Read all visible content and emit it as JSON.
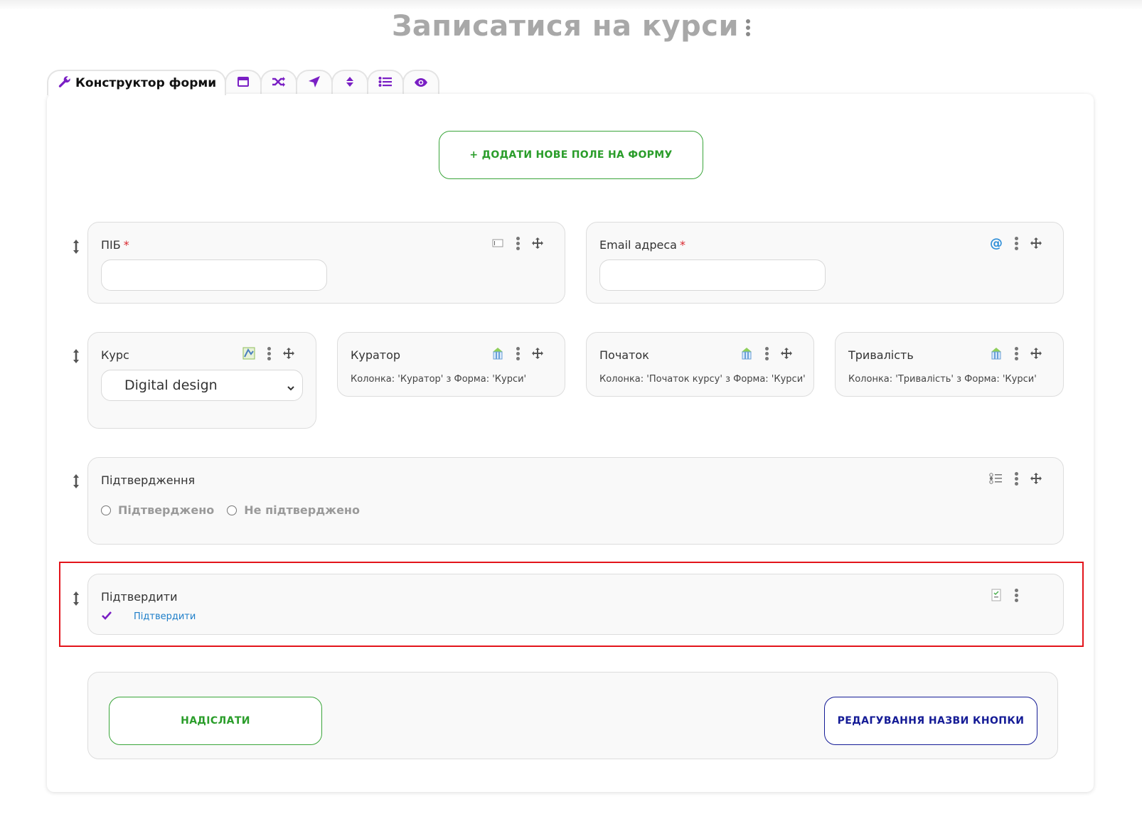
{
  "page": {
    "title": "Записатися на курси",
    "title_menu_icon": "kebab-vertical-icon"
  },
  "tabs": [
    {
      "label": "Конструктор форми",
      "icon": "wrench-icon",
      "active": true
    },
    {
      "label": "",
      "icon": "window-icon"
    },
    {
      "label": "",
      "icon": "shuffle-icon"
    },
    {
      "label": "",
      "icon": "location-arrow-icon"
    },
    {
      "label": "",
      "icon": "sort-icon"
    },
    {
      "label": "",
      "icon": "list-icon"
    },
    {
      "label": "",
      "icon": "eye-icon"
    }
  ],
  "toolbar": {
    "add_field_label": "+ ДОДАТИ НОВЕ ПОЛЕ НА ФОРМУ"
  },
  "fields": {
    "pib": {
      "label": "ПІБ",
      "required_mark": "*",
      "value": ""
    },
    "email": {
      "label": "Email адреса",
      "required_mark": "*",
      "value": ""
    },
    "course": {
      "label": "Курс",
      "selected": "Digital design"
    },
    "curator": {
      "label": "Куратор",
      "info": "Колонка: 'Куратор' з Форма: 'Курси'"
    },
    "start": {
      "label": "Початок",
      "info": "Колонка: 'Початок курсу' з Форма: 'Курси'"
    },
    "duration": {
      "label": "Тривалість",
      "info": "Колонка: 'Тривалість' з Форма: 'Курси'"
    },
    "confirmation": {
      "label": "Підтвердження",
      "options": [
        "Підтверджено",
        "Не підтверджено"
      ]
    },
    "confirm_check": {
      "label": "Підтвердити",
      "check_label": "Підтвердити"
    }
  },
  "footer": {
    "submit_label": "НАДІСЛАТИ",
    "rename_label": "РЕДАГУВАННЯ НАЗВИ КНОПКИ"
  },
  "colors": {
    "accent_purple": "#7a1fc4",
    "green": "#2a9d2a",
    "navy": "#141b96",
    "required_red": "#d9272e",
    "highlight_red": "#e3141b",
    "link_blue": "#1d7ec9"
  }
}
